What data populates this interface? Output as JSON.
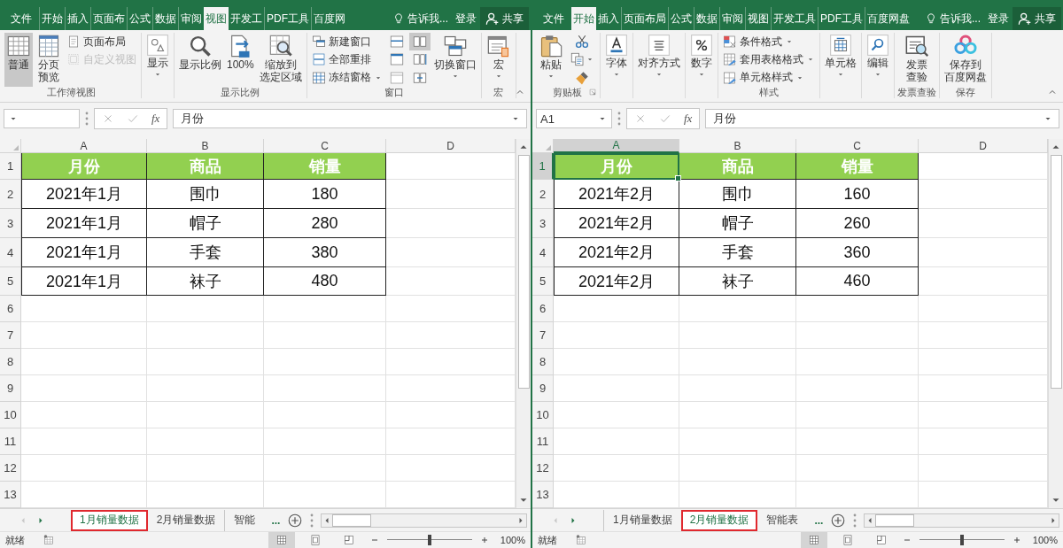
{
  "windows": [
    {
      "ribbon_tabs": [
        {
          "label": "文件",
          "selected": false
        },
        {
          "label": "开始",
          "selected": false
        },
        {
          "label": "插入",
          "selected": false
        },
        {
          "label": "页面布",
          "selected": false
        },
        {
          "label": "公式",
          "selected": false
        },
        {
          "label": "数据",
          "selected": false
        },
        {
          "label": "审阅",
          "selected": false
        },
        {
          "label": "视图",
          "selected": true
        },
        {
          "label": "开发工",
          "selected": false
        },
        {
          "label": "PDF工具",
          "selected": false
        },
        {
          "label": "百度网",
          "selected": false
        }
      ],
      "tell_me": "告诉我...",
      "sign_in": "登录",
      "share": "共享",
      "ribbon_groups": [
        {
          "label": "工作簿视图",
          "launcher": false,
          "commands": [
            {
              "kind": "large",
              "label": "普通",
              "selected": true,
              "disabled": false,
              "dropdown": false
            },
            {
              "kind": "large",
              "lines": [
                "分页",
                "预览"
              ],
              "selected": false,
              "disabled": false,
              "dropdown": false
            },
            {
              "kind": "small",
              "label": "页面布局",
              "selected": false,
              "disabled": false,
              "dropdown": false
            },
            {
              "kind": "small",
              "label": "自定义视图",
              "selected": false,
              "disabled": true,
              "dropdown": false
            }
          ]
        },
        {
          "launcher": false,
          "commands": [
            {
              "kind": "collapsed",
              "label": "显示",
              "selected": false,
              "disabled": false,
              "dropdown": true
            }
          ]
        },
        {
          "label": "显示比例",
          "launcher": false,
          "commands": [
            {
              "kind": "large",
              "label": "显示比例",
              "selected": false,
              "disabled": false,
              "dropdown": false
            },
            {
              "kind": "large",
              "label": "100%",
              "selected": false,
              "disabled": false,
              "dropdown": false
            },
            {
              "kind": "large",
              "lines": [
                "缩放到",
                "选定区域"
              ],
              "selected": false,
              "disabled": false,
              "dropdown": false
            }
          ]
        },
        {
          "label": "窗口",
          "launcher": false,
          "commands": [
            {
              "kind": "small",
              "label": "新建窗口",
              "selected": false,
              "disabled": false,
              "dropdown": false
            },
            {
              "kind": "small",
              "label": "全部重排",
              "selected": false,
              "disabled": false,
              "dropdown": false
            },
            {
              "kind": "small",
              "label": "冻结窗格",
              "selected": false,
              "disabled": false,
              "dropdown": true
            },
            {
              "kind": "icon",
              "selected": false,
              "disabled": false,
              "dropdown": false
            },
            {
              "kind": "icon",
              "selected": false,
              "disabled": false,
              "dropdown": false
            },
            {
              "kind": "icon",
              "selected": false,
              "disabled": false,
              "dropdown": false
            },
            {
              "kind": "icon",
              "selected": true,
              "disabled": false,
              "dropdown": false
            },
            {
              "kind": "icon",
              "selected": false,
              "disabled": false,
              "dropdown": false
            },
            {
              "kind": "icon",
              "selected": false,
              "disabled": false,
              "dropdown": false
            },
            {
              "kind": "large",
              "label": "切换窗口",
              "selected": false,
              "disabled": false,
              "dropdown": true
            }
          ]
        },
        {
          "label": "宏",
          "launcher": false,
          "commands": [
            {
              "kind": "large",
              "label": "宏",
              "selected": false,
              "disabled": false,
              "dropdown": true
            }
          ]
        }
      ],
      "formula": "月份",
      "fx_label": "fx",
      "column_headers": [
        {
          "label": "A",
          "selected": false
        },
        {
          "label": "B",
          "selected": false
        },
        {
          "label": "C",
          "selected": false
        },
        {
          "label": "D",
          "selected": false
        }
      ],
      "row_headers": [
        {
          "label": "1",
          "selected": false
        },
        {
          "label": "2",
          "selected": false
        },
        {
          "label": "3",
          "selected": false
        },
        {
          "label": "4",
          "selected": false
        },
        {
          "label": "5",
          "selected": false
        },
        {
          "label": "6",
          "selected": false
        },
        {
          "label": "7",
          "selected": false
        },
        {
          "label": "8",
          "selected": false
        },
        {
          "label": "9",
          "selected": false
        },
        {
          "label": "10",
          "selected": false
        },
        {
          "label": "11",
          "selected": false
        },
        {
          "label": "12",
          "selected": false
        },
        {
          "label": "13",
          "selected": false
        }
      ],
      "table": {
        "header": [
          {
            "text": "月份",
            "selected": false
          },
          {
            "text": "商品",
            "selected": false
          },
          {
            "text": "销量",
            "selected": false
          }
        ],
        "rows": [
          [
            "2021年1月",
            "围巾",
            "180"
          ],
          [
            "2021年1月",
            "帽子",
            "280"
          ],
          [
            "2021年1月",
            "手套",
            "380"
          ],
          [
            "2021年1月",
            "袜子",
            "480"
          ]
        ]
      },
      "sheet_tabs": [
        {
          "label": "1月销量数据",
          "selected": true,
          "highlighted": true
        },
        {
          "label": "2月销量数据",
          "selected": false,
          "highlighted": false
        },
        {
          "label": "智能",
          "selected": false,
          "highlighted": false
        }
      ],
      "more_tabs": "...",
      "status": "就绪",
      "zoom": {
        "level": 0.5,
        "label": "100%"
      }
    },
    {
      "ribbon_tabs": [
        {
          "label": "文件",
          "selected": false
        },
        {
          "label": "开始",
          "selected": true
        },
        {
          "label": "插入",
          "selected": false
        },
        {
          "label": "页面布局",
          "selected": false
        },
        {
          "label": "公式",
          "selected": false
        },
        {
          "label": "数据",
          "selected": false
        },
        {
          "label": "审阅",
          "selected": false
        },
        {
          "label": "视图",
          "selected": false
        },
        {
          "label": "开发工具",
          "selected": false
        },
        {
          "label": "PDF工具",
          "selected": false
        },
        {
          "label": "百度网盘",
          "selected": false
        }
      ],
      "tell_me": "告诉我...",
      "sign_in": "登录",
      "share": "共享",
      "ribbon_groups": [
        {
          "label": "剪贴板",
          "launcher": true,
          "commands": [
            {
              "kind": "large",
              "label": "粘贴",
              "selected": false,
              "disabled": false,
              "dropdown": true
            },
            {
              "kind": "icon",
              "selected": false,
              "disabled": false,
              "dropdown": false
            },
            {
              "kind": "icon",
              "selected": false,
              "disabled": false,
              "dropdown": true
            },
            {
              "kind": "icon",
              "selected": false,
              "disabled": false,
              "dropdown": false
            }
          ]
        },
        {
          "launcher": false,
          "commands": [
            {
              "kind": "collapsed",
              "label": "字体",
              "selected": false,
              "disabled": false,
              "dropdown": true
            }
          ]
        },
        {
          "launcher": false,
          "commands": [
            {
              "kind": "collapsed",
              "label": "对齐方式",
              "selected": false,
              "disabled": false,
              "dropdown": true
            }
          ]
        },
        {
          "launcher": false,
          "commands": [
            {
              "kind": "collapsed",
              "label": "数字",
              "selected": false,
              "disabled": false,
              "dropdown": true
            }
          ]
        },
        {
          "label": "样式",
          "launcher": false,
          "commands": [
            {
              "kind": "small",
              "label": "条件格式",
              "selected": false,
              "disabled": false,
              "dropdown": true
            },
            {
              "kind": "small",
              "label": "套用表格格式",
              "selected": false,
              "disabled": false,
              "dropdown": true
            },
            {
              "kind": "small",
              "label": "单元格样式",
              "selected": false,
              "disabled": false,
              "dropdown": true
            }
          ]
        },
        {
          "launcher": false,
          "commands": [
            {
              "kind": "collapsed",
              "label": "单元格",
              "selected": false,
              "disabled": false,
              "dropdown": true
            }
          ]
        },
        {
          "launcher": false,
          "commands": [
            {
              "kind": "collapsed",
              "label": "编辑",
              "selected": false,
              "disabled": false,
              "dropdown": true
            }
          ]
        },
        {
          "label": "发票查验",
          "launcher": false,
          "commands": [
            {
              "kind": "large",
              "lines": [
                "发票",
                "查验"
              ],
              "selected": false,
              "disabled": false,
              "dropdown": false
            }
          ]
        },
        {
          "label": "保存",
          "launcher": false,
          "commands": [
            {
              "kind": "large",
              "lines": [
                "保存到",
                "百度网盘"
              ],
              "selected": false,
              "disabled": false,
              "dropdown": false
            }
          ]
        }
      ],
      "name_box": "A1",
      "formula": "月份",
      "fx_label": "fx",
      "column_headers": [
        {
          "label": "A",
          "selected": true
        },
        {
          "label": "B",
          "selected": false
        },
        {
          "label": "C",
          "selected": false
        },
        {
          "label": "D",
          "selected": false
        }
      ],
      "row_headers": [
        {
          "label": "1",
          "selected": true
        },
        {
          "label": "2",
          "selected": false
        },
        {
          "label": "3",
          "selected": false
        },
        {
          "label": "4",
          "selected": false
        },
        {
          "label": "5",
          "selected": false
        },
        {
          "label": "6",
          "selected": false
        },
        {
          "label": "7",
          "selected": false
        },
        {
          "label": "8",
          "selected": false
        },
        {
          "label": "9",
          "selected": false
        },
        {
          "label": "10",
          "selected": false
        },
        {
          "label": "11",
          "selected": false
        },
        {
          "label": "12",
          "selected": false
        },
        {
          "label": "13",
          "selected": false
        }
      ],
      "table": {
        "header": [
          {
            "text": "月份",
            "selected": true
          },
          {
            "text": "商品",
            "selected": false
          },
          {
            "text": "销量",
            "selected": false
          }
        ],
        "rows": [
          [
            "2021年2月",
            "围巾",
            "160"
          ],
          [
            "2021年2月",
            "帽子",
            "260"
          ],
          [
            "2021年2月",
            "手套",
            "360"
          ],
          [
            "2021年2月",
            "袜子",
            "460"
          ]
        ]
      },
      "sheet_tabs": [
        {
          "label": "1月销量数据",
          "selected": false,
          "highlighted": false
        },
        {
          "label": "2月销量数据",
          "selected": true,
          "highlighted": true
        },
        {
          "label": "智能表",
          "selected": false,
          "highlighted": false
        }
      ],
      "more_tabs": "...",
      "status": "就绪",
      "zoom": {
        "level": 0.5,
        "label": "100%"
      }
    }
  ]
}
